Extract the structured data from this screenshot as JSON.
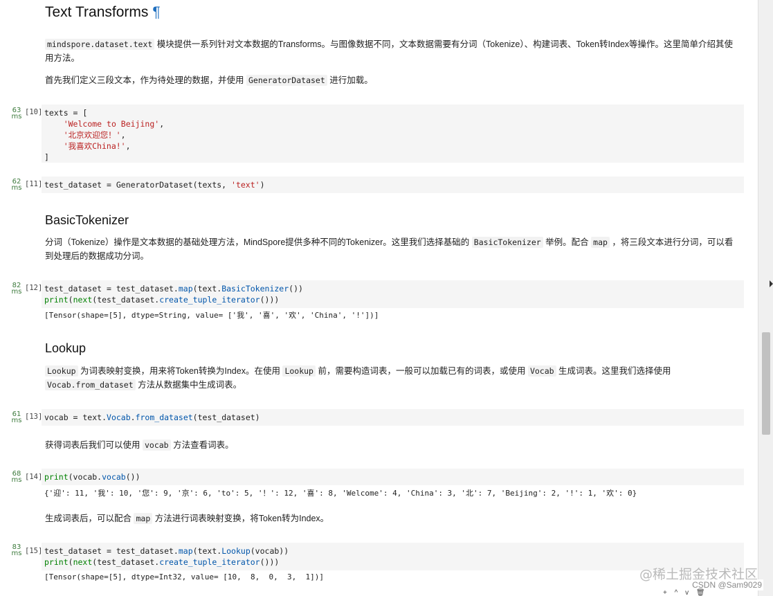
{
  "section": {
    "title": "Text Transforms",
    "anchor": "¶",
    "intro": {
      "code": "mindspore.dataset.text",
      "text": " 模块提供一系列针对文本数据的Transforms。与图像数据不同，文本数据需要有分词（Tokenize）、构建词表、Token转Index等操作。这里简单介绍其使用方法。"
    },
    "intro2": {
      "before": "首先我们定义三段文本，作为待处理的数据，并使用 ",
      "code": "GeneratorDataset",
      "after": " 进行加载。"
    }
  },
  "cells": {
    "c10": {
      "time_val": "63",
      "time_unit": "ms",
      "exec": "[10]"
    },
    "c11": {
      "time_val": "62",
      "time_unit": "ms",
      "exec": "[11]"
    },
    "c12": {
      "time_val": "82",
      "time_unit": "ms",
      "exec": "[12]",
      "output": "[Tensor(shape=[5], dtype=String, value= ['我', '喜', '欢', 'China', '!'])]"
    },
    "c13": {
      "time_val": "61",
      "time_unit": "ms",
      "exec": "[13]"
    },
    "c14": {
      "time_val": "68",
      "time_unit": "ms",
      "exec": "[14]",
      "output": "{'迎': 11, '我': 10, '您': 9, '京': 6, 'to': 5, '！': 12, '喜': 8, 'Welcome': 4, 'China': 3, '北': 7, 'Beijing': 2, '!': 1, '欢': 0}"
    },
    "c15": {
      "time_val": "83",
      "time_unit": "ms",
      "exec": "[15]",
      "output": "[Tensor(shape=[5], dtype=Int32, value= [10,  8,  0,  3,  1])]"
    }
  },
  "code10": {
    "l1": "texts = [",
    "l2": "'Welcome to Beijing'",
    "l3": "'北京欢迎您！'",
    "l4": "'我喜欢China!'",
    "l5": "]"
  },
  "code11": {
    "a": "test_dataset = GeneratorDataset(texts, ",
    "s": "'text'",
    "b": ")"
  },
  "basic": {
    "title": "BasicTokenizer",
    "p_before": "分词（Tokenize）操作是文本数据的基础处理方法，MindSpore提供多种不同的Tokenizer。这里我们选择基础的 ",
    "p_code1": "BasicTokenizer",
    "p_mid": " 举例。配合 ",
    "p_code2": "map",
    "p_after": " ，将三段文本进行分词，可以看到处理后的数据成功分词。"
  },
  "code12": {
    "a": "test_dataset = test_dataset.",
    "map": "map",
    "b": "(text.",
    "cls": "BasicTokenizer",
    "c": "())",
    "print": "print",
    "d": "(",
    "next": "next",
    "e": "(test_dataset.",
    "cti": "create_tuple_iterator",
    "f": "()))"
  },
  "lookup": {
    "title": "Lookup",
    "code1": "Lookup",
    "t1": " 为词表映射变换，用来将Token转换为Index。在使用 ",
    "code2": "Lookup",
    "t2": " 前，需要构造词表，一般可以加载已有的词表，或使用 ",
    "code3": "Vocab",
    "t3": " 生成词表。这里我们选择使用 ",
    "code4": "Vocab.from_dataset",
    "t4": " 方法从数据集中生成词表。"
  },
  "code13": {
    "a": "vocab = text.",
    "cls": "Vocab",
    "dot": ".",
    "fd": "from_dataset",
    "b": "(test_dataset)"
  },
  "vocabnote": {
    "before": "获得词表后我们可以使用 ",
    "code": "vocab",
    "after": " 方法查看词表。"
  },
  "code14": {
    "print": "print",
    "a": "(vocab.",
    "vocab": "vocab",
    "b": "())"
  },
  "mapnote": {
    "before": "生成词表后，可以配合 ",
    "code": "map",
    "after": " 方法进行词表映射变换，将Token转为Index。"
  },
  "code15": {
    "a": "test_dataset = test_dataset.",
    "map": "map",
    "b": "(text.",
    "cls": "Lookup",
    "c": "(vocab))",
    "print": "print",
    "d": "(",
    "next": "next",
    "e": "(test_dataset.",
    "cti": "create_tuple_iterator",
    "f": "()))"
  },
  "footer": {
    "watermark": "@稀土掘金技术社区",
    "csdn": "CSDN @Sam9029",
    "tools": "+ ^ v 🗑"
  }
}
